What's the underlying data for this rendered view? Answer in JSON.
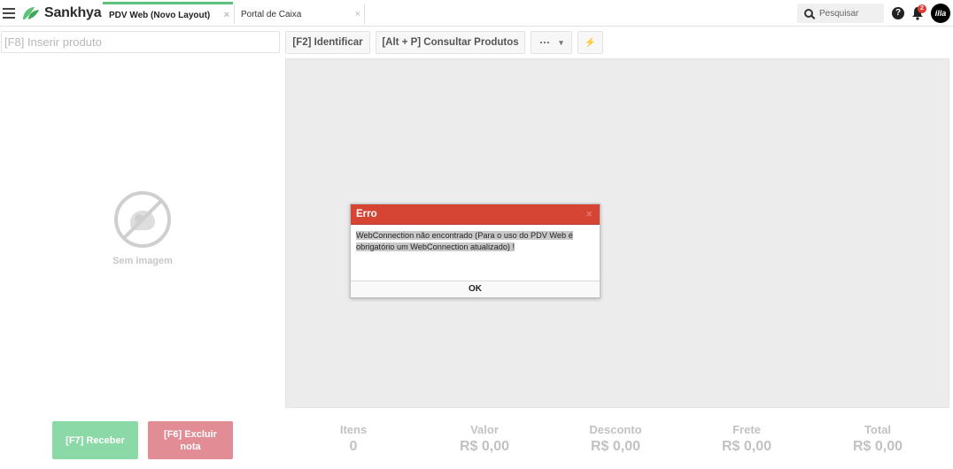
{
  "topbar": {
    "brand": "Sankhya",
    "tabs": [
      {
        "label": "PDV Web (Novo Layout)",
        "active": true
      },
      {
        "label": "Portal de Caixa",
        "active": false
      }
    ],
    "tab_close": "×",
    "search_placeholder": "Pesquisar",
    "help": "?",
    "notification_count": "2",
    "avatar_text": "illa"
  },
  "toolbar": {
    "product_placeholder": "[F8] Inserir produto",
    "identify_label": "[F2] Identificar",
    "consult_label": "[Alt + P] Consultar Produtos",
    "more_label": "···",
    "more_caret": "▾",
    "flash_label": "⚡"
  },
  "product": {
    "no_image_label": "Sem imagem"
  },
  "actions": {
    "receive_label": "[F7] Receber",
    "delete_label": "[F6] Excluir nota"
  },
  "totals": [
    {
      "label": "Itens",
      "value": "0"
    },
    {
      "label": "Valor",
      "value": "R$ 0,00"
    },
    {
      "label": "Desconto",
      "value": "R$ 0,00"
    },
    {
      "label": "Frete",
      "value": "R$ 0,00"
    },
    {
      "label": "Total",
      "value": "R$ 0,00"
    }
  ],
  "dialog": {
    "title": "Erro",
    "close": "×",
    "message": "WebConnection não encontrado (Para o uso do PDV Web é obrigatório um WebConnection atualizado) !",
    "ok_label": "OK"
  },
  "colors": {
    "accent_green": "#5fc27a",
    "receive_button": "#8cd9a8",
    "delete_button": "#e28d95",
    "dialog_header": "#d64434",
    "badge": "#e53935"
  }
}
